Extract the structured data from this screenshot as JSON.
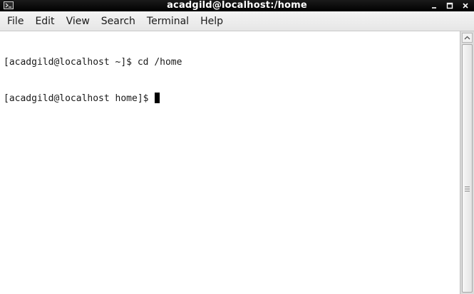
{
  "window": {
    "title": "acadgild@localhost:/home"
  },
  "menu": {
    "items": [
      "File",
      "Edit",
      "View",
      "Search",
      "Terminal",
      "Help"
    ]
  },
  "terminal": {
    "lines": [
      "[acadgild@localhost ~]$ cd /home",
      "[acadgild@localhost home]$ "
    ]
  },
  "icons": {
    "app": "terminal-icon",
    "minimize": "minimize-icon",
    "maximize": "maximize-icon",
    "close": "close-icon"
  },
  "colors": {
    "titlebar": "#000000",
    "menubar": "#ececec",
    "terminal_bg": "#ffffff",
    "terminal_fg": "#1a1a1a"
  }
}
